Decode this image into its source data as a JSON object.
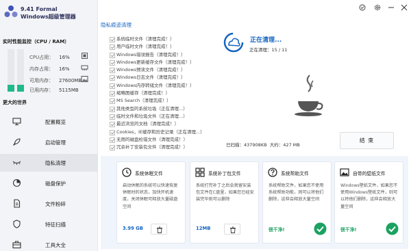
{
  "app": {
    "version": "9.41 Formal",
    "name": "Windows超级管理器"
  },
  "colors": {
    "accent": "#1565c0",
    "green": "#1fb98a",
    "success": "#1aa260"
  },
  "realtime": {
    "title": "实时性能监控（CPU / RAM）",
    "cpu": {
      "label": "CPU占用：",
      "value": "16%",
      "level": 0.16
    },
    "mem": {
      "label": "内存占用：",
      "value": "16%",
      "level": 0.16
    },
    "avail": {
      "label": "可用内存：",
      "value": "27600MB"
    },
    "used": {
      "label": "已用内存：",
      "value": "5115MB"
    }
  },
  "more_title": "更大的世界",
  "nav": [
    {
      "label": "配置概览",
      "icon": "monitor-icon"
    },
    {
      "label": "启动管理",
      "icon": "rocket-icon"
    },
    {
      "label": "隐私清理",
      "icon": "eye-closed-icon"
    },
    {
      "label": "磁盘保护",
      "icon": "disk-pie-icon"
    },
    {
      "label": "文件粉碎",
      "icon": "file-shred-icon"
    },
    {
      "label": "特征扫描",
      "icon": "shield-icon"
    },
    {
      "label": "工具大全",
      "icon": "toolbox-icon"
    }
  ],
  "active_nav": "隐私清理",
  "section_title": "隐私痕迹清理",
  "items": [
    "系统临时文件（清理完成！）",
    "用户临时文件（清理完成！）",
    "Windows错误报告（清理完成！）",
    "Windows更新缓存文件（清理完成！）",
    "Windows预读文件（清理完成！）",
    "Windows日志文件（清理完成！）",
    "Windows内存转储文件（清理完成！）",
    "缩略图缓存（清理完成！）",
    "MS Search（清理完成！）",
    "其他类型的系统垃圾（正在清理...）",
    "临时文件和垃圾文件（正在清理...）",
    "最近浏览的文档（清理完成！）",
    "Cookies，IE缓存和历史记录（正在清理...）",
    "无用的磁盘检错文件（清理完成！）",
    "冗余补丁安装包文件（清理完成！）"
  ],
  "cleaning": {
    "title": "正在清理...",
    "progress_label": "正在清理：",
    "progress": "15 / 11",
    "found_label": "已扫描：",
    "found_value": "437908KB",
    "size_label": "大约：",
    "size_value": "427 MB",
    "end_button": "结 束"
  },
  "cards": [
    {
      "title": "系统休眠文件",
      "icon": "hibernate-icon",
      "desc": "启动休眠的系统可以快速恢复休眠时的状态，加快开机速度，关闭休眠可释放大量磁盘空间",
      "value": "3.99 GB",
      "status": "trash"
    },
    {
      "title": "系统补丁包文件",
      "icon": "windows-grid-icon",
      "desc": "系统打完补丁之后会我留安装包文件在C盘里，如果您已经安装完毕则可以删除",
      "value": "12MB",
      "status": "trash"
    },
    {
      "title": "系统帮助文件",
      "icon": "help-icon",
      "desc": "系统帮助文件，如果您不使用系统帮助功能，则可以将他们删除，这样会释放大量空间",
      "value": "很干净!",
      "status": "ok"
    },
    {
      "title": "自带的壁纸文件",
      "icon": "wallpaper-icon",
      "desc": "Windows壁纸文件，如果您不使用Windows壁纸文件，则可以将他们删除，这样会释放大量空间",
      "value": "很干净!",
      "status": "ok"
    }
  ]
}
